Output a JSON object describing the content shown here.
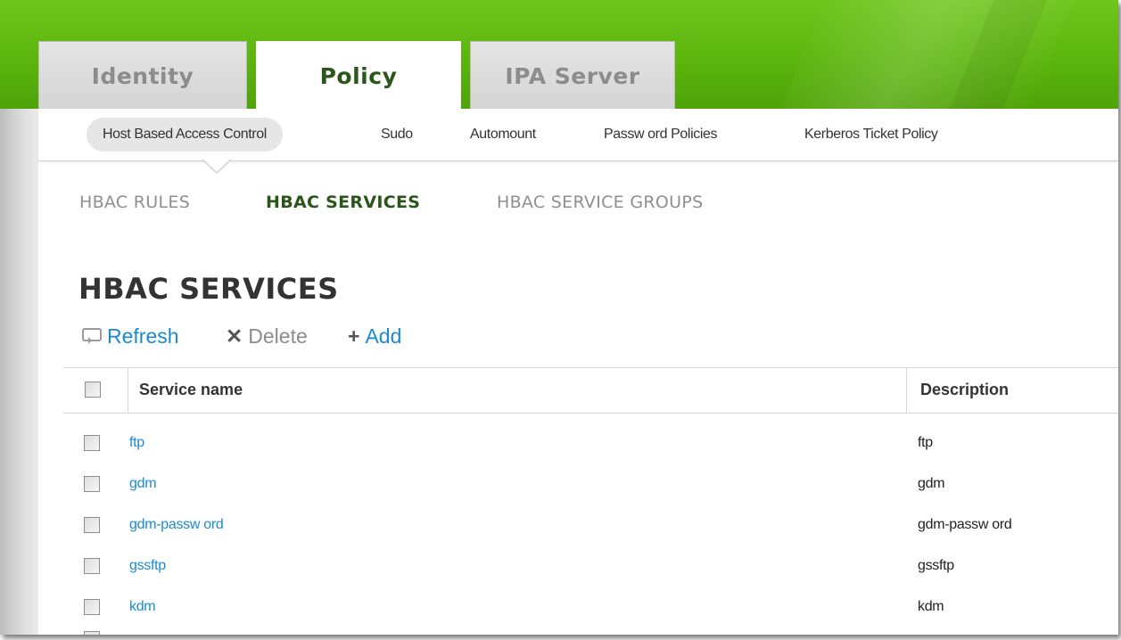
{
  "colors": {
    "banner_green": "#5cb50d",
    "active_green_text": "#2a561c",
    "link_blue": "#1a8bd2",
    "inactive_tab_text": "#8c8c8c"
  },
  "top_tabs": [
    {
      "label": "Identity",
      "active": false
    },
    {
      "label": "Policy",
      "active": true
    },
    {
      "label": "IPA Server",
      "active": false
    }
  ],
  "subnav": [
    {
      "label": "Host Based Access Control",
      "active": true
    },
    {
      "label": "Sudo",
      "active": false
    },
    {
      "label": "Automount",
      "active": false
    },
    {
      "label": "Passw ord Policies",
      "active": false
    },
    {
      "label": "Kerberos Ticket Policy",
      "active": false
    }
  ],
  "section_tabs": [
    {
      "label": "HBAC RULES",
      "active": false
    },
    {
      "label": "HBAC SERVICES",
      "active": true
    },
    {
      "label": "HBAC SERVICE GROUPS",
      "active": false
    }
  ],
  "page_title": "HBAC SERVICES",
  "actions": {
    "refresh": {
      "label": "Refresh",
      "icon": "refresh-icon"
    },
    "delete": {
      "label": "Delete",
      "icon": "close-icon"
    },
    "add": {
      "label": "Add",
      "icon": "plus-icon"
    }
  },
  "table": {
    "columns": [
      "Service name",
      "Description"
    ],
    "rows": [
      {
        "name": "ftp",
        "description": "ftp"
      },
      {
        "name": "gdm",
        "description": "gdm"
      },
      {
        "name": "gdm-passw ord",
        "description": "gdm-passw ord"
      },
      {
        "name": "gssftp",
        "description": "gssftp"
      },
      {
        "name": "kdm",
        "description": "kdm"
      }
    ]
  }
}
